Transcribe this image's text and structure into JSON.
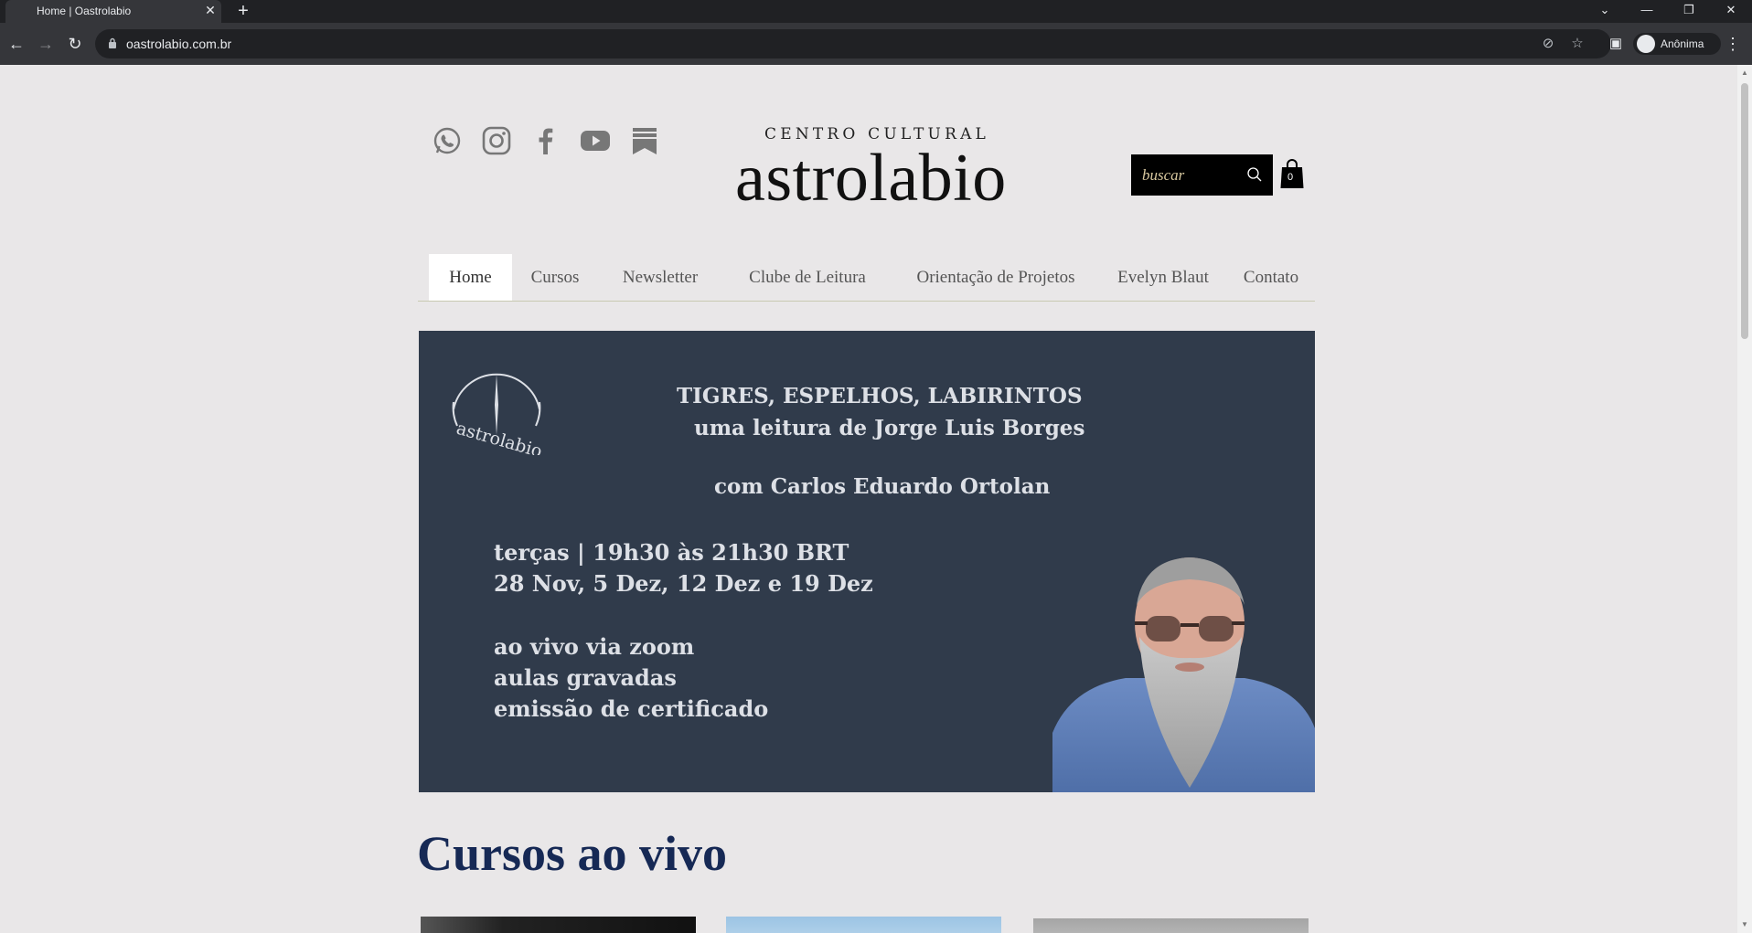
{
  "browser": {
    "tab_title": "Home | Oastrolabio",
    "url": "oastrolabio.com.br",
    "profile_label": "Anônima"
  },
  "header": {
    "social_icons": [
      "whatsapp-icon",
      "instagram-icon",
      "facebook-icon",
      "youtube-icon",
      "bookmark-icon"
    ],
    "brand_small": "CENTRO CULTURAL",
    "brand_large": "astrolabio",
    "search_placeholder": "buscar",
    "cart_count": "0"
  },
  "nav": {
    "items": [
      {
        "label": "Home"
      },
      {
        "label": "Cursos"
      },
      {
        "label": "Newsletter"
      },
      {
        "label": "Clube de Leitura"
      },
      {
        "label": "Orientação de Projetos"
      },
      {
        "label": "Evelyn Blaut"
      },
      {
        "label": "Contato"
      }
    ]
  },
  "banner": {
    "logo_text": "astrolabio",
    "title": "TIGRES, ESPELHOS, LABIRINTOS",
    "subtitle": "uma leitura de Jorge Luis Borges",
    "with": "com Carlos Eduardo Ortolan",
    "lines": [
      "terças | 19h30 às 21h30 BRT",
      "28 Nov, 5 Dez, 12 Dez e 19 Dez",
      "ao vivo via zoom",
      "aulas gravadas",
      "emissão de certificado"
    ]
  },
  "main": {
    "section_title": "Cursos ao vivo"
  },
  "colors": {
    "banner_bg": "#303b4b",
    "section_title": "#162955",
    "page_bg": "#e9e7e8"
  }
}
